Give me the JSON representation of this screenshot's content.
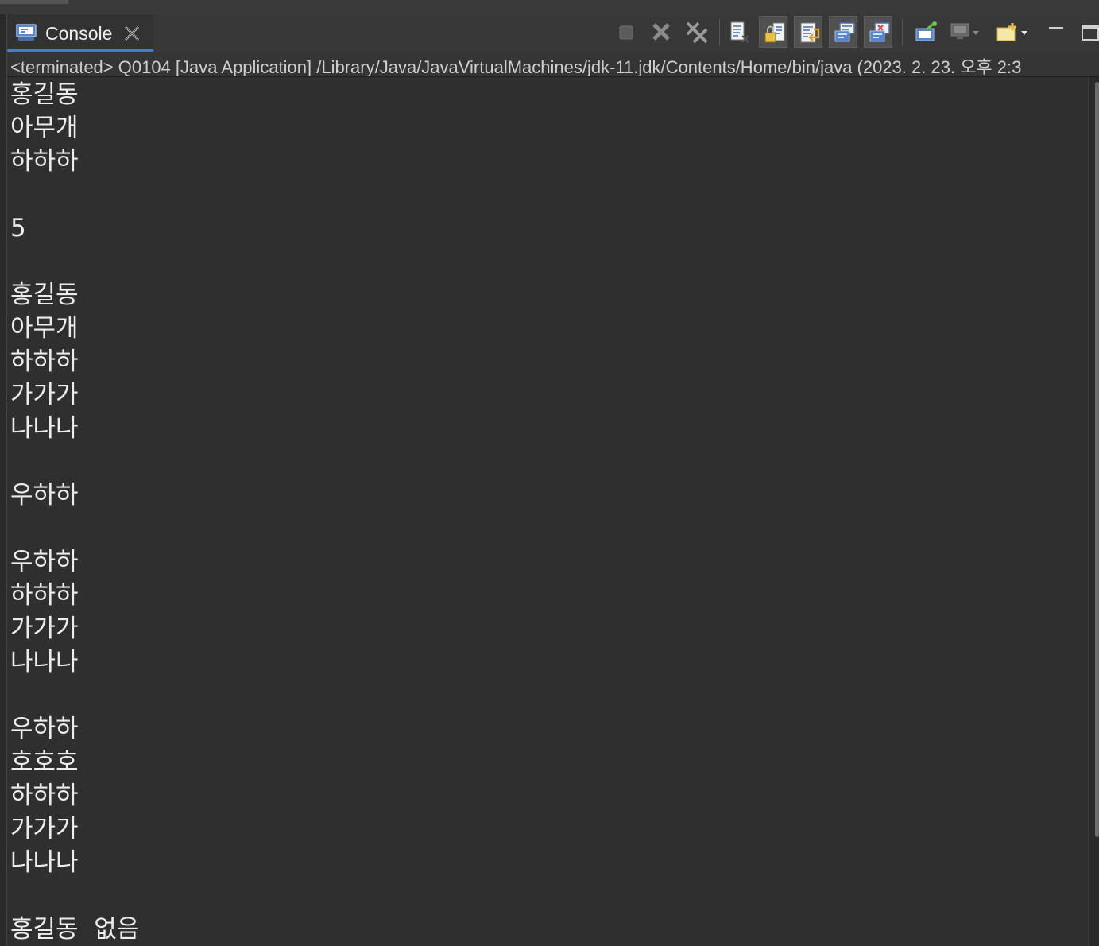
{
  "tab": {
    "label": "Console",
    "icon": "console-icon",
    "close_icon": "close-icon"
  },
  "toolbar": {
    "buttons": [
      {
        "name": "terminate",
        "icon": "terminate-icon"
      },
      {
        "name": "remove-launch",
        "icon": "remove-launch-icon"
      },
      {
        "name": "remove-all-terminated",
        "icon": "remove-all-terminated-icon"
      },
      {
        "name": "clear-console",
        "icon": "clear-console-icon"
      },
      {
        "name": "scroll-lock",
        "icon": "scroll-lock-icon"
      },
      {
        "name": "word-wrap",
        "icon": "word-wrap-icon"
      },
      {
        "name": "show-on-stdout",
        "icon": "show-on-stdout-icon"
      },
      {
        "name": "show-on-stderr",
        "icon": "show-on-stderr-icon"
      },
      {
        "name": "pin-console",
        "icon": "pin-console-icon"
      },
      {
        "name": "display-selected-console",
        "icon": "display-console-icon"
      },
      {
        "name": "open-console",
        "icon": "open-console-icon"
      },
      {
        "name": "minimize",
        "icon": "minimize-icon"
      },
      {
        "name": "maximize",
        "icon": "maximize-icon"
      }
    ],
    "colors": {
      "accent": "#4a7bbf",
      "warning": "#e6c24a",
      "error": "#d9534f",
      "success": "#6cc24a"
    }
  },
  "status": {
    "text": "<terminated> Q0104 [Java Application] /Library/Java/JavaVirtualMachines/jdk-11.jdk/Contents/Home/bin/java  (2023. 2. 23. 오후 2:3"
  },
  "output": {
    "lines": [
      "홍길동",
      "아무개",
      "하하하",
      "",
      "5",
      "",
      "홍길동",
      "아무개",
      "하하하",
      "가가가",
      "나나나",
      "",
      "우하하",
      "",
      "우하하",
      "하하하",
      "가가가",
      "나나나",
      "",
      "우하하",
      "호호호",
      "하하하",
      "가가가",
      "나나나",
      "",
      "홍길동  없음"
    ]
  }
}
